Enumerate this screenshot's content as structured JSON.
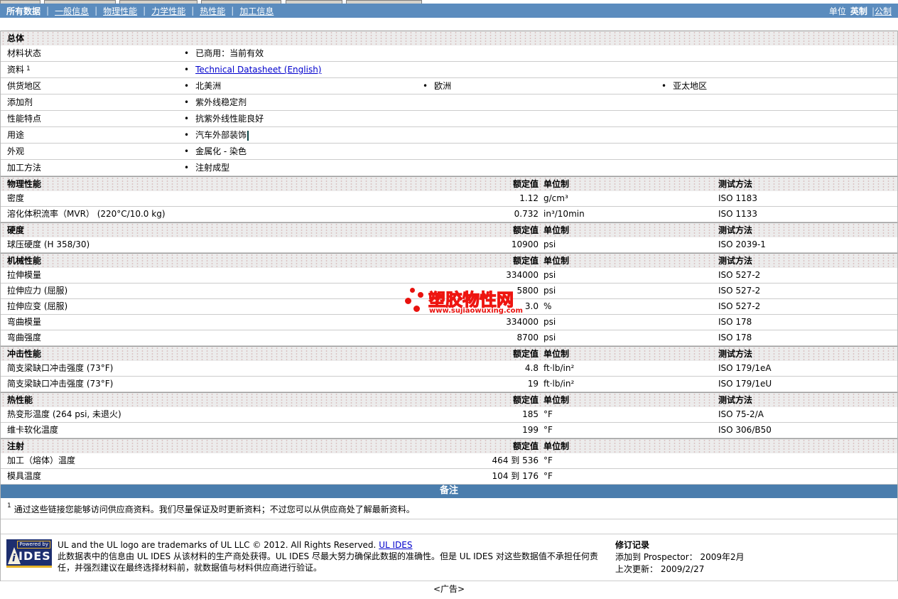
{
  "nav": {
    "separator": "|",
    "links": [
      {
        "label": "所有数据",
        "current": true
      },
      {
        "label": "一般信息",
        "current": false
      },
      {
        "label": "物理性能",
        "current": false
      },
      {
        "label": "力学性能",
        "current": false
      },
      {
        "label": "热性能",
        "current": false
      },
      {
        "label": "加工信息",
        "current": false
      }
    ],
    "units": {
      "label": "单位",
      "imperial": "英制",
      "separator": "|",
      "metric": "公制"
    }
  },
  "general": {
    "title": "总体",
    "rows": [
      {
        "label": "材料状态",
        "values": [
          "已商用：当前有效"
        ]
      },
      {
        "label": "资料",
        "footnote_marker": "1",
        "values": [
          "Technical Datasheet (English)"
        ],
        "link": true
      },
      {
        "label": "供货地区",
        "values": [
          "北美洲",
          "欧洲",
          "亚太地区"
        ]
      },
      {
        "label": "添加剂",
        "values": [
          "紫外线稳定剂"
        ]
      },
      {
        "label": "性能特点",
        "values": [
          "抗紫外线性能良好"
        ]
      },
      {
        "label": "用途",
        "values": [
          "汽车外部装饰"
        ],
        "cursor": true
      },
      {
        "label": "外观",
        "values": [
          "金属化 - 染色"
        ]
      },
      {
        "label": "加工方法",
        "values": [
          "注射成型"
        ]
      }
    ]
  },
  "property_sections": [
    {
      "title": "物理性能",
      "col_value": "额定值",
      "col_unit": "单位制",
      "col_method": "测试方法",
      "has_method": true,
      "rows": [
        {
          "label": "密度",
          "value": "1.12",
          "unit": "g/cm³",
          "method": "ISO 1183"
        },
        {
          "label": "溶化体积流率（MVR） (220°C/10.0 kg)",
          "value": "0.732",
          "unit": "in³/10min",
          "method": "ISO 1133"
        }
      ]
    },
    {
      "title": "硬度",
      "col_value": "额定值",
      "col_unit": "单位制",
      "col_method": "测试方法",
      "has_method": true,
      "rows": [
        {
          "label": "球压硬度 (H 358/30)",
          "value": "10900",
          "unit": "psi",
          "method": "ISO 2039-1"
        }
      ]
    },
    {
      "title": "机械性能",
      "col_value": "额定值",
      "col_unit": "单位制",
      "col_method": "测试方法",
      "has_method": true,
      "rows": [
        {
          "label": "拉伸模量",
          "value": "334000",
          "unit": "psi",
          "method": "ISO 527-2"
        },
        {
          "label": "拉伸应力 (屈服)",
          "value": "5800",
          "unit": "psi",
          "method": "ISO 527-2"
        },
        {
          "label": "拉伸应变 (屈服)",
          "value": "3.0",
          "unit": "%",
          "method": "ISO 527-2"
        },
        {
          "label": "弯曲模量",
          "value": "334000",
          "unit": "psi",
          "method": "ISO 178"
        },
        {
          "label": "弯曲强度",
          "value": "8700",
          "unit": "psi",
          "method": "ISO 178"
        }
      ]
    },
    {
      "title": "冲击性能",
      "col_value": "额定值",
      "col_unit": "单位制",
      "col_method": "测试方法",
      "has_method": true,
      "rows": [
        {
          "label": "简支梁缺口冲击强度 (73°F)",
          "value": "4.8",
          "unit": "ft·lb/in²",
          "method": "ISO 179/1eA"
        },
        {
          "label": "简支梁缺口冲击强度 (73°F)",
          "value": "19",
          "unit": "ft·lb/in²",
          "method": "ISO 179/1eU"
        }
      ]
    },
    {
      "title": "热性能",
      "col_value": "额定值",
      "col_unit": "单位制",
      "col_method": "测试方法",
      "has_method": true,
      "rows": [
        {
          "label": "热变形温度 (264 psi, 未退火)",
          "value": "185",
          "unit": "°F",
          "method": "ISO 75-2/A"
        },
        {
          "label": "维卡软化温度",
          "value": "199",
          "unit": "°F",
          "method": "ISO 306/B50"
        }
      ]
    },
    {
      "title": "注射",
      "col_value": "额定值",
      "col_unit": "单位制",
      "col_method": "",
      "has_method": false,
      "rows": [
        {
          "label": "加工（熔体）温度",
          "value": "464 到 536",
          "unit": "°F",
          "method": ""
        },
        {
          "label": "模具温度",
          "value": "104 到 176",
          "unit": "°F",
          "method": ""
        }
      ]
    }
  ],
  "notes": {
    "title": "备注"
  },
  "footnote": {
    "marker": "1",
    "text": "通过这些链接您能够访问供应商资料。我们尽量保证及时更新资料；不过您可以从供应商处了解最新资料。"
  },
  "watermark": {
    "name": "塑胶物性网",
    "url": "www.sujiaowuxing.com"
  },
  "footer": {
    "logo": {
      "powered_by": "Powered by",
      "brand": "IDES",
      "i": "i"
    },
    "trademark": "UL and the UL logo are trademarks of UL LLC © 2012. All Rights Reserved.",
    "ul_ides_link": "UL IDES",
    "disclaimer": "此数据表中的信息由 UL IDES 从该材料的生产商处获得。UL IDES 尽最大努力确保此数据的准确性。但是 UL IDES 对这些数据值不承担任何责任，并强烈建议在最终选择材料前，就数据值与材料供应商进行验证。",
    "revision": {
      "title": "修订记录",
      "added": "添加到 Prospector： 2009年2月",
      "updated": "上次更新： 2009/2/27"
    }
  },
  "ad": {
    "label": "<广告>"
  },
  "colors": {
    "navbar": "#5b8cbe",
    "notes_bar": "#4a7dad",
    "link": "#0000cc",
    "watermark_red": "#e8120e",
    "ides_navy": "#1d2e6f",
    "ides_yellow": "#e8b427"
  }
}
